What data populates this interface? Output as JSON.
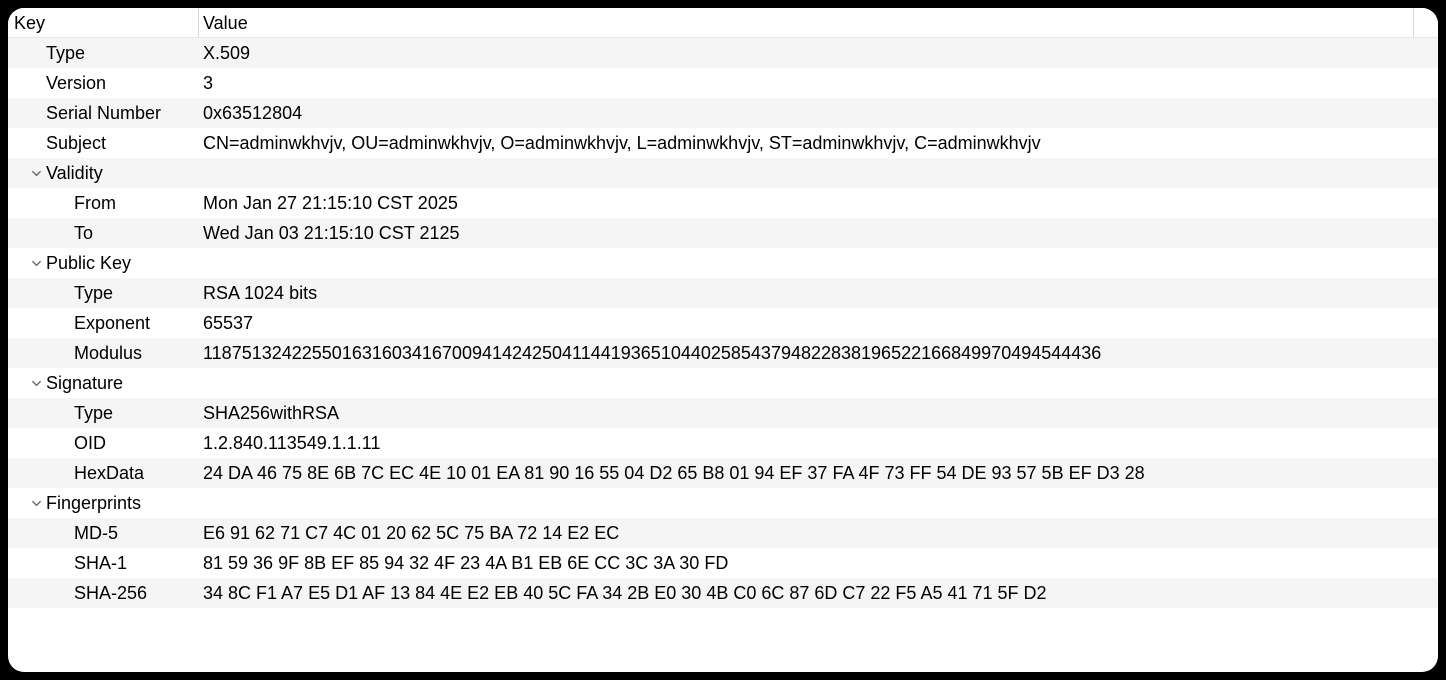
{
  "columns": {
    "key": "Key",
    "value": "Value"
  },
  "rows": [
    {
      "indent": 1,
      "expand": false,
      "key": "Type",
      "value": "X.509"
    },
    {
      "indent": 1,
      "expand": false,
      "key": "Version",
      "value": "3"
    },
    {
      "indent": 1,
      "expand": false,
      "key": "Serial Number",
      "value": "0x63512804"
    },
    {
      "indent": 1,
      "expand": false,
      "key": "Subject",
      "value": "CN=adminwkhvjv, OU=adminwkhvjv, O=adminwkhvjv, L=adminwkhvjv, ST=adminwkhvjv, C=adminwkhvjv"
    },
    {
      "indent": 1,
      "expand": true,
      "key": "Validity",
      "value": ""
    },
    {
      "indent": 2,
      "expand": false,
      "key": "From",
      "value": "Mon Jan 27 21:15:10 CST 2025"
    },
    {
      "indent": 2,
      "expand": false,
      "key": "To",
      "value": "Wed Jan 03 21:15:10 CST 2125"
    },
    {
      "indent": 1,
      "expand": true,
      "key": "Public Key",
      "value": ""
    },
    {
      "indent": 2,
      "expand": false,
      "key": "Type",
      "value": "RSA 1024 bits"
    },
    {
      "indent": 2,
      "expand": false,
      "key": "Exponent",
      "value": "65537"
    },
    {
      "indent": 2,
      "expand": false,
      "key": "Modulus",
      "value": "118751324225501631603416700941424250411441936510440258543794822838196522166849970494544436"
    },
    {
      "indent": 1,
      "expand": true,
      "key": "Signature",
      "value": ""
    },
    {
      "indent": 2,
      "expand": false,
      "key": "Type",
      "value": "SHA256withRSA"
    },
    {
      "indent": 2,
      "expand": false,
      "key": "OID",
      "value": "1.2.840.113549.1.1.11"
    },
    {
      "indent": 2,
      "expand": false,
      "key": "HexData",
      "value": "24 DA 46 75 8E 6B 7C EC 4E 10 01 EA 81 90 16 55 04 D2 65 B8 01 94 EF 37 FA 4F 73 FF 54 DE 93 57 5B EF D3 28"
    },
    {
      "indent": 1,
      "expand": true,
      "key": "Fingerprints",
      "value": ""
    },
    {
      "indent": 2,
      "expand": false,
      "key": "MD-5",
      "value": "E6 91 62 71 C7 4C 01 20 62 5C 75 BA 72 14 E2 EC"
    },
    {
      "indent": 2,
      "expand": false,
      "key": "SHA-1",
      "value": "81 59 36 9F 8B EF 85 94 32 4F 23 4A B1 EB 6E CC 3C 3A 30 FD"
    },
    {
      "indent": 2,
      "expand": false,
      "key": "SHA-256",
      "value": "34 8C F1 A7 E5 D1 AF 13 84 4E E2 EB 40 5C FA 34 2B E0 30 4B C0 6C 87 6D C7 22 F5 A5 41 71 5F D2"
    },
    {
      "indent": 0,
      "expand": false,
      "key": "",
      "value": ""
    }
  ]
}
